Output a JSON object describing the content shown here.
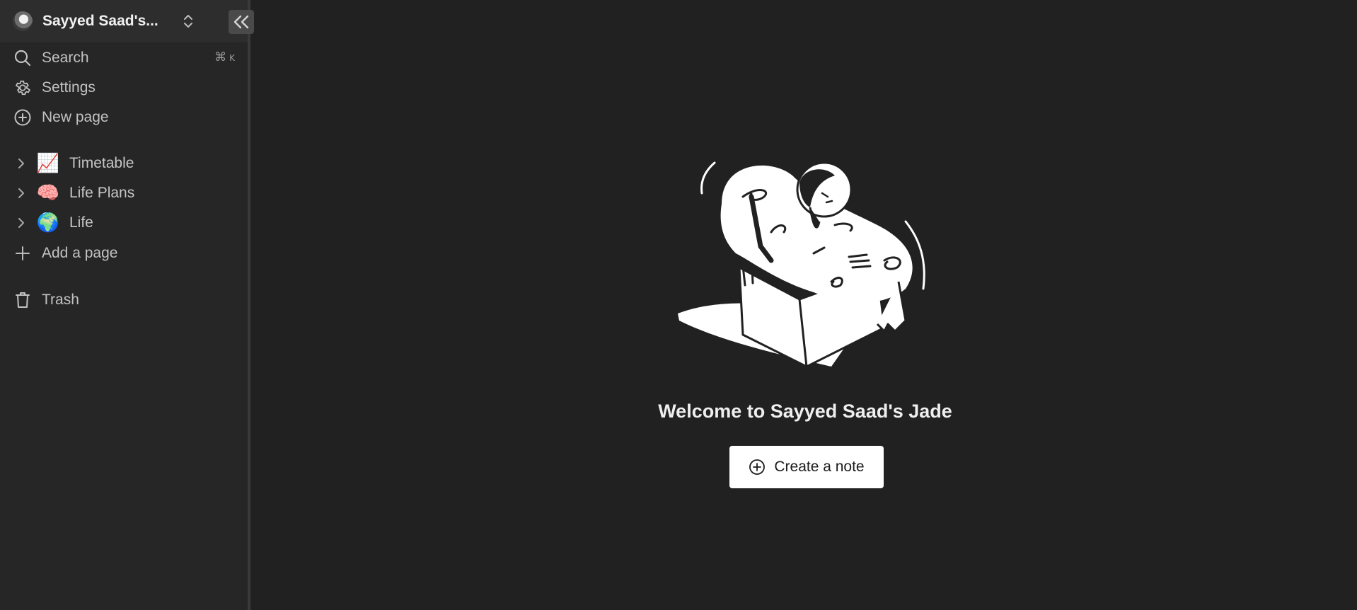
{
  "workspace": {
    "name": "Sayyed Saad's..."
  },
  "nav": {
    "search_label": "Search",
    "search_shortcut_symbol": "⌘",
    "search_shortcut_key": "K",
    "settings_label": "Settings",
    "new_page_label": "New page"
  },
  "pages": [
    {
      "emoji": "📈",
      "label": "Timetable"
    },
    {
      "emoji": "🧠",
      "label": "Life Plans"
    },
    {
      "emoji": "🌍",
      "label": "Life"
    }
  ],
  "add_page_label": "Add a page",
  "trash_label": "Trash",
  "main": {
    "welcome": "Welcome to Sayyed Saad's Jade",
    "create_note_label": "Create a note"
  },
  "colors": {
    "background": "#212121",
    "sidebar": "#262626",
    "button": "#ffffff"
  }
}
